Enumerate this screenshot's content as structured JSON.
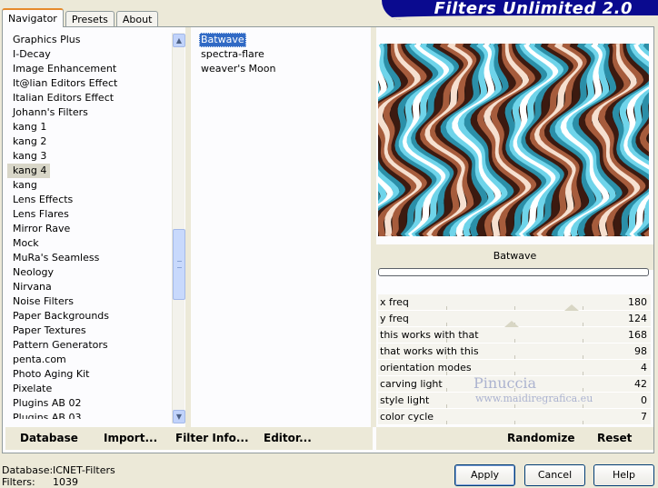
{
  "tabs": [
    {
      "label": "Navigator"
    },
    {
      "label": "Presets"
    },
    {
      "label": "About"
    }
  ],
  "banner": {
    "title": "Filters Unlimited 2.0"
  },
  "categories": [
    "Graphics Plus",
    "I-Decay",
    "Image Enhancement",
    "It@lian Editors Effect",
    "Italian Editors Effect",
    "Johann's Filters",
    "kang 1",
    "kang 2",
    "kang 3",
    "kang 4",
    "kang",
    "Lens Effects",
    "Lens Flares",
    "Mirror Rave",
    "Mock",
    "MuRa's Seamless",
    "Neology",
    "Nirvana",
    "Noise Filters",
    "Paper Backgrounds",
    "Paper Textures",
    "Pattern Generators",
    "penta.com",
    "Photo Aging Kit",
    "Pixelate",
    "Plugins AB 02",
    "Plugins AB 03"
  ],
  "selected_category": "kang 4",
  "filters": [
    "Batwave",
    "spectra-flare",
    "weaver's Moon"
  ],
  "selected_filter": "Batwave",
  "left_buttons": {
    "database": "Database",
    "import": "Import...",
    "filter_info": "Filter Info...",
    "editor": "Editor..."
  },
  "preview_name": "Batwave",
  "params": [
    {
      "label": "x freq",
      "value": "180",
      "level": 0.71
    },
    {
      "label": "y freq",
      "value": "124",
      "level": 0.49
    },
    {
      "label": "this works with that",
      "value": "168",
      "level": null
    },
    {
      "label": "that works with this",
      "value": "98",
      "level": null
    },
    {
      "label": "orientation modes",
      "value": "4",
      "level": null
    },
    {
      "label": "carving light",
      "value": "42",
      "level": null
    },
    {
      "label": "style light",
      "value": "0",
      "level": null
    },
    {
      "label": "color cycle",
      "value": "7",
      "level": null
    }
  ],
  "right_buttons": {
    "randomize": "Randomize",
    "reset": "Reset"
  },
  "watermark": {
    "name": "Pinuccia",
    "url": "www.maidiregrafica.eu"
  },
  "status": {
    "database_label": "Database:",
    "database_value": "ICNET-Filters",
    "filters_label": "Filters:",
    "filters_value": "1039"
  },
  "dialog_buttons": {
    "apply": "Apply",
    "cancel": "Cancel",
    "help": "Help"
  },
  "preview_colors": {
    "dark": "#3c1a10",
    "mid": "#a65c3c",
    "light": "#f6e0d0",
    "cyan": "#6fd4ea",
    "teal": "#2b8fa8",
    "white": "#ffffff"
  }
}
